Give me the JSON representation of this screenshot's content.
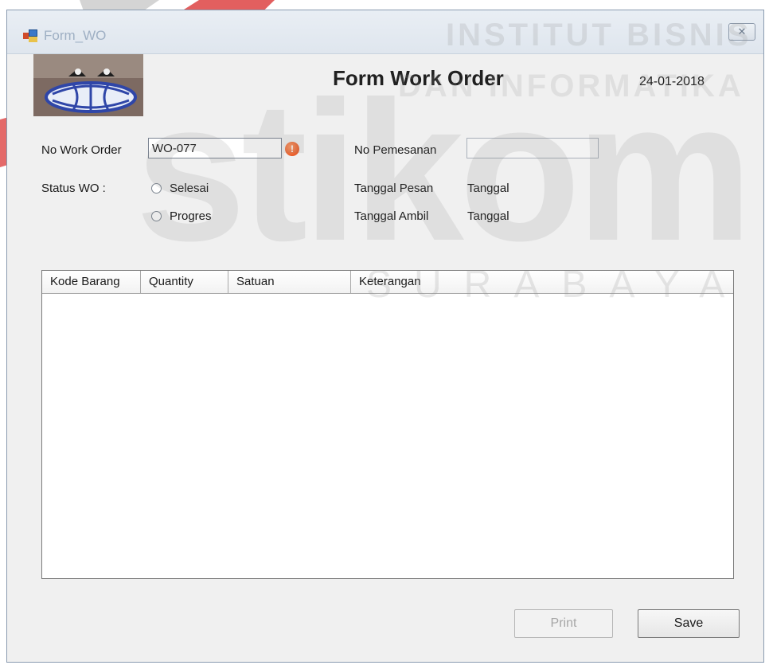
{
  "window": {
    "title": "Form_WO",
    "close_glyph": "✕"
  },
  "header": {
    "form_title": "Form Work Order",
    "date": "24-01-2018"
  },
  "fields": {
    "no_work_order_label": "No Work Order",
    "no_work_order_value": "WO-077",
    "error_glyph": "!",
    "no_pemesanan_label": "No Pemesanan",
    "no_pemesanan_value": "",
    "status_label": "Status WO :",
    "status_options": [
      "Selesai",
      "Progres"
    ],
    "tanggal_pesan_label": "Tanggal Pesan",
    "tanggal_pesan_value": "Tanggal",
    "tanggal_ambil_label": "Tanggal Ambil",
    "tanggal_ambil_value": "Tanggal"
  },
  "grid": {
    "columns": [
      "Kode Barang",
      "Quantity",
      "Satuan",
      "Keterangan"
    ],
    "rows": []
  },
  "buttons": {
    "print": "Print",
    "save": "Save"
  },
  "watermark": {
    "line1": "INSTITUT BISNIS",
    "line2": "DAN INFORMATIKA",
    "brand": "stikom",
    "city": "SURABAYA"
  },
  "colors": {
    "window_bg": "#f0f0f0",
    "watermark_red": "#d82a2a",
    "error_orange": "#e04412"
  },
  "icons": {
    "app": "form-window-icon",
    "close": "close-icon",
    "error": "error-icon",
    "logo": "globe-logo"
  }
}
